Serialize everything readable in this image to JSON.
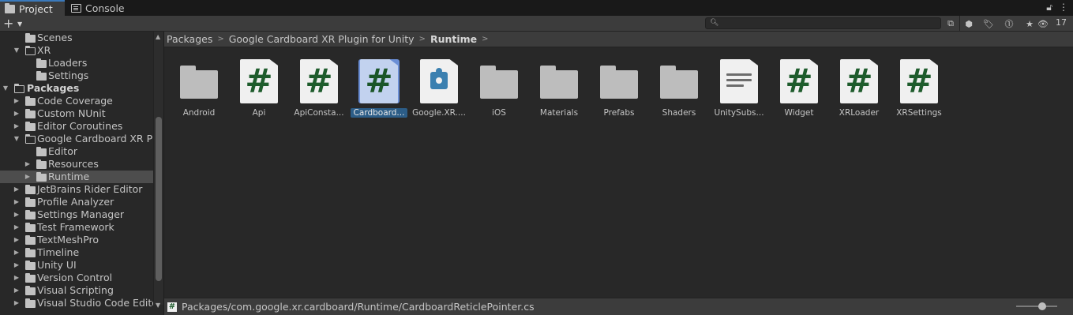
{
  "tabs": [
    {
      "label": "Project",
      "icon": "folder-icon"
    },
    {
      "label": "Console",
      "icon": "console-icon"
    }
  ],
  "toolbar": {
    "add_label": "+",
    "search_value": "",
    "hidden_count": "17"
  },
  "tree": {
    "items": [
      {
        "label": "Scenes"
      },
      {
        "label": "XR"
      },
      {
        "label": "Loaders"
      },
      {
        "label": "Settings"
      },
      {
        "label": "Packages"
      },
      {
        "label": "Code Coverage"
      },
      {
        "label": "Custom NUnit"
      },
      {
        "label": "Editor Coroutines"
      },
      {
        "label": "Google Cardboard XR Plugin for Unity"
      },
      {
        "label": "Editor"
      },
      {
        "label": "Resources"
      },
      {
        "label": "Runtime"
      },
      {
        "label": "JetBrains Rider Editor"
      },
      {
        "label": "Profile Analyzer"
      },
      {
        "label": "Settings Manager"
      },
      {
        "label": "Test Framework"
      },
      {
        "label": "TextMeshPro"
      },
      {
        "label": "Timeline"
      },
      {
        "label": "Unity UI"
      },
      {
        "label": "Version Control"
      },
      {
        "label": "Visual Scripting"
      },
      {
        "label": "Visual Studio Code Editor"
      }
    ]
  },
  "breadcrumb": {
    "items": [
      "Packages",
      "Google Cardboard XR Plugin for Unity",
      "Runtime"
    ]
  },
  "assets": [
    {
      "label": "Android",
      "kind": "folder"
    },
    {
      "label": "Api",
      "kind": "script"
    },
    {
      "label": "ApiConsta...",
      "kind": "script"
    },
    {
      "label": "Cardboard...",
      "kind": "script"
    },
    {
      "label": "Google.XR....",
      "kind": "assembly"
    },
    {
      "label": "iOS",
      "kind": "folder"
    },
    {
      "label": "Materials",
      "kind": "folder"
    },
    {
      "label": "Prefabs",
      "kind": "folder"
    },
    {
      "label": "Shaders",
      "kind": "folder"
    },
    {
      "label": "UnitySubs...",
      "kind": "text"
    },
    {
      "label": "Widget",
      "kind": "script"
    },
    {
      "label": "XRLoader",
      "kind": "script"
    },
    {
      "label": "XRSettings",
      "kind": "script"
    }
  ],
  "status": {
    "path": "Packages/com.google.xr.cardboard/Runtime/CardboardReticlePointer.cs"
  },
  "glyphs": {
    "hash": "#",
    "chevron": ">"
  }
}
